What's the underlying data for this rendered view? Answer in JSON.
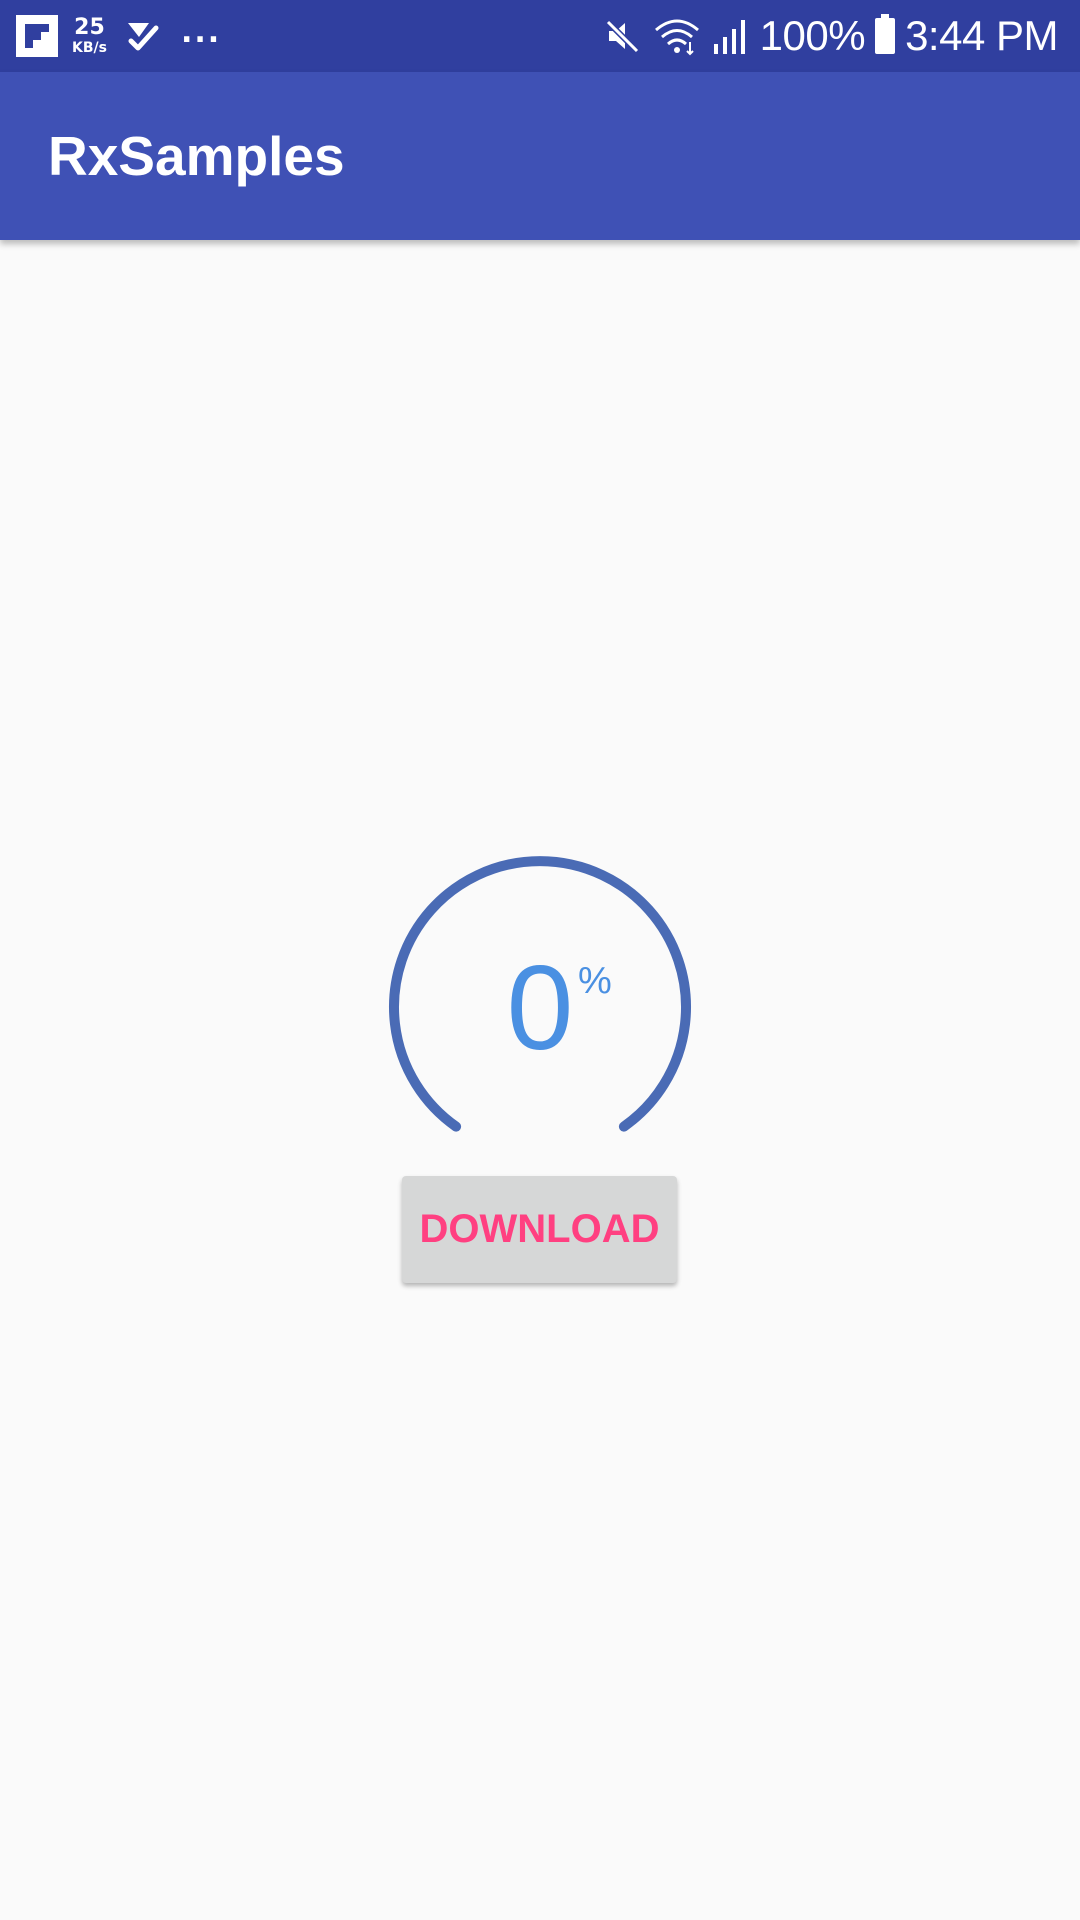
{
  "status_bar": {
    "net_speed_value": "25",
    "net_speed_unit": "KB/s",
    "overflow": "...",
    "battery": "100%",
    "time": "3:44 PM",
    "icons": [
      "flipboard-icon",
      "task-check-icon",
      "mute-icon",
      "wifi-icon",
      "signal-icon",
      "battery-icon"
    ]
  },
  "app_bar": {
    "title": "RxSamples"
  },
  "progress": {
    "value": "0",
    "unit": "%",
    "fraction": 0
  },
  "actions": {
    "download_label": "DOWNLOAD"
  },
  "colors": {
    "status_bar": "#303f9f",
    "app_bar": "#3f51b5",
    "arc": "#4a6bb5",
    "value_text": "#4a90e2",
    "button_text": "#ff4081",
    "button_bg": "#d6d7d7"
  }
}
